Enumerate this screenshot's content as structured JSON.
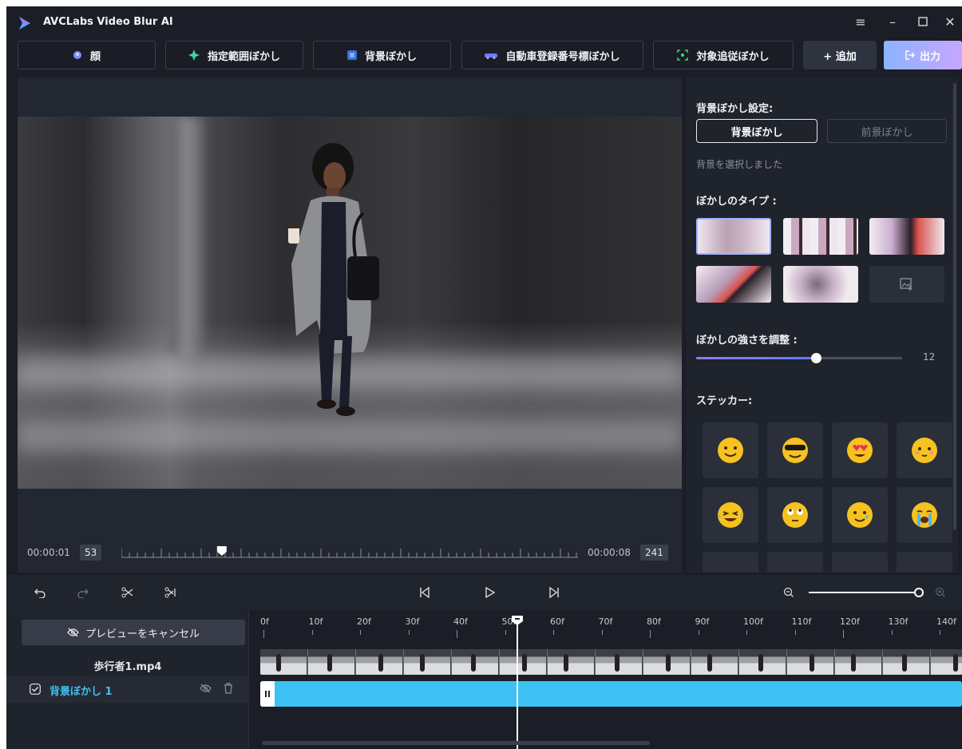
{
  "app": {
    "title": "AVCLabs Video Blur AI"
  },
  "toolbar": {
    "face": "顔",
    "region": "指定範囲ぼかし",
    "background": "背景ぼかし",
    "license_plate": "自動車登録番号標ぼかし",
    "tracking": "対象追従ぼかし",
    "add": "+ 追加",
    "export": "出力",
    "colors": {
      "export_gradient_start": "#8ab4ff",
      "export_gradient_end": "#c8a6ff"
    }
  },
  "preview": {
    "start_time": "00:00:01",
    "start_frame": "53",
    "end_time": "00:00:08",
    "end_frame": "241",
    "playhead_fraction": 0.22
  },
  "settings": {
    "title": "背景ぼかし設定:",
    "segment_background": "背景ぼかし",
    "segment_foreground": "前景ぼかし",
    "status": "背景を選択しました",
    "blur_type_label": "ぼかしのタイプ :",
    "blur_strength_label": "ぼかしの強さを調整 :",
    "blur_strength_value": "12",
    "blur_strength_fraction": 0.58,
    "sticker_label": "ステッカー:",
    "blur_types": [
      "gaussian-blur",
      "mosaic",
      "pixel-blur",
      "glass-blur",
      "noise-blur",
      "custom-image"
    ],
    "stickers": [
      "smile",
      "sunglasses",
      "heart-eyes",
      "blush",
      "laughing-tears",
      "rolling-eyes",
      "teary-smile",
      "crying"
    ]
  },
  "timeline": {
    "cancel_preview": "プレビューをキャンセル",
    "track_file": "歩行者1.mp4",
    "layer_name": "背景ぼかし 1",
    "ruler_labels": [
      "0f",
      "10f",
      "20f",
      "30f",
      "40f",
      "50f",
      "60f",
      "70f",
      "80f",
      "90f",
      "100f",
      "110f",
      "120f",
      "130f",
      "140f"
    ],
    "accent_color": "#3ec1f3"
  }
}
